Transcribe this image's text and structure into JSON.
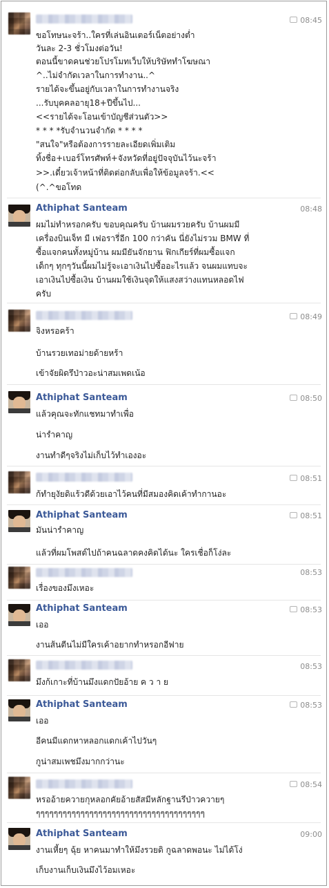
{
  "messages": [
    {
      "sender": "",
      "time": "08:45",
      "lines": [
        "ขอโทษนะจร้า..ใครที่เล่นอินเตอร์เน็ตอย่างต่ำ",
        "วันละ 2-3 ชั่วโมงต่อวัน!",
        "ตอนนี้ขาดคนช่วยโปรโมทเว็บให้บริษัททำโฆษณา",
        "^..ไม่จำกัดเวลาในการทำงาน..^",
        "รายได้จะขึ้นอยู่กับเวลาในการทำงานจริง",
        "...รับบุคคลอายุ18+ปีขึ้นไป...",
        "<<รายได้จะโอนเข้าบัญชีส่วนตัว>>",
        "* * * *รับจำนวนจำกัด * * * *",
        "\"สนใจ\"หรือต้องการรายละเอียดเพิ่มเติม",
        "ทิ้งชื่อ+เบอร์โทรศัพท์+จังหวัดที่อยู่ปัจจุบันไว้นะจร้า",
        ">>.เดี๋ยวเจ้าหน้าที่ติดต่อกลับเพื่อให้ข้อมูลจร้า.<<",
        "(^.^ขอโทด"
      ]
    },
    {
      "sender": "Athiphat Santeam",
      "time": "08:48",
      "lines": [
        "ผมไม่ทำหรอกครับ ขอบคุณครับ บ้านผมรวยครับ บ้านผมมี",
        "เครื่องบินเจ็ท มี เฟอรารี่อีก 100 กว่าคัน นี่ยังไม่รวม BMW ที่",
        "ซื้อแจกคนทั้งหมู่บ้าน ผมมียันจักยาน ฟิกเกียร์ที่ผมซื้อแจก",
        "เด็กๆ ทุกๆวันนี้ผมไม่รู้จะเอาเงินไปซื้ออะไรแล้ว จนผมแทบจะ",
        "เอาเงินไปซื้อเงิน บ้านผมใช้เงินจุดให้แสงสว่างแทนหลอดไฟ",
        "ครับ"
      ]
    },
    {
      "sender": "",
      "time": "08:49",
      "lines": [
        "จิงหรอคร้า",
        "บ้านรวยเทอม่ายด้ายหร้า",
        "เข้าจัยผิดรึป่าวอะน่าสมเพดเน้อ"
      ]
    },
    {
      "sender": "Athiphat Santeam",
      "time": "08:50",
      "lines": [
        "แล้วคุณจะทักแชทมาทำเพื่อ",
        "น่ารำคาญ",
        "งานทำดีๆจริงไม่เก็บไว้ทำเองอะ"
      ]
    },
    {
      "sender": "",
      "time": "08:51",
      "lines": [
        "ก้ทำยุงัยดิแร้วดีด้วยเอาไว้คนที่มีสมองคิดเค้าทำกานอะ"
      ]
    },
    {
      "sender": "Athiphat Santeam",
      "time": "08:51",
      "lines": [
        "มันน่ารำคาญ",
        "แล้วที่ผมโพสต์ไปถ้าคนฉลาดคงคิดได้นะ ใครเชื่อก็โง่ละ"
      ]
    },
    {
      "sender": "",
      "time": "08:53",
      "lines": [
        "เรื่องของมึงเหอะ"
      ]
    },
    {
      "sender": "Athiphat Santeam",
      "time": "08:53",
      "lines": [
        "เออ",
        "งานส้นตีนไม่มีใครเค้าอยากทำหรอกอีฟาย"
      ]
    },
    {
      "sender": "",
      "time": "08:53",
      "lines": [
        "มึงก้เกาะที่บ้านมึงแดกปัยอ้าย ค ว า ย"
      ]
    },
    {
      "sender": "Athiphat Santeam",
      "time": "08:53",
      "lines": [
        "เออ",
        "อีคนมีแดกหาหลอกแดกเค้าไปวันๆ",
        "กูน่าสมเพชมึงมากกว่านะ"
      ]
    },
    {
      "sender": "",
      "time": "08:54",
      "lines": [
        "หรออ้ายควายกุหลอกคัยอ้ายสัสมีหลักฐานรึป่าวควายๆ",
        "ๆๆๆๆๆๆๆๆๆๆๆๆๆๆๆๆๆๆๆๆๆๆๆๆๆๆๆๆๆๆๆๆๆๆๆๆๆๆ"
      ]
    },
    {
      "sender": "Athiphat Santeam",
      "time": "09:00",
      "lines": [
        "งานเหี้ยๆ ฉุ้ย หาคนมาทำให้มึงรวยดิ กูฉลาดพอนะ ไม่ได้โง่",
        "เก็บงานเก็บเงินมึงไว้อมเหอะ"
      ]
    }
  ],
  "colors": {
    "name": "#3b5998",
    "time": "#8c8c8c",
    "text": "#222222"
  },
  "icons": {
    "time_prefix": "chat-bubble-icon"
  }
}
